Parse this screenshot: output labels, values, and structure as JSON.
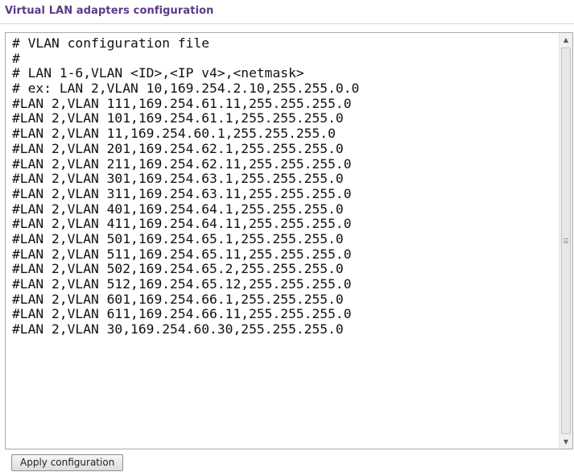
{
  "section": {
    "title": "Virtual LAN adapters configuration"
  },
  "editor": {
    "lines": [
      "# VLAN configuration file",
      "#",
      "# LAN 1-6,VLAN <ID>,<IP v4>,<netmask>",
      "# ex: LAN 2,VLAN 10,169.254.2.10,255.255.0.0",
      "#LAN 2,VLAN 111,169.254.61.11,255.255.255.0",
      "#LAN 2,VLAN 101,169.254.61.1,255.255.255.0",
      "#LAN 2,VLAN 11,169.254.60.1,255.255.255.0",
      "#LAN 2,VLAN 201,169.254.62.1,255.255.255.0",
      "#LAN 2,VLAN 211,169.254.62.11,255.255.255.0",
      "#LAN 2,VLAN 301,169.254.63.1,255.255.255.0",
      "#LAN 2,VLAN 311,169.254.63.11,255.255.255.0",
      "#LAN 2,VLAN 401,169.254.64.1,255.255.255.0",
      "#LAN 2,VLAN 411,169.254.64.11,255.255.255.0",
      "#LAN 2,VLAN 501,169.254.65.1,255.255.255.0",
      "#LAN 2,VLAN 511,169.254.65.11,255.255.255.0",
      "#LAN 2,VLAN 502,169.254.65.2,255.255.255.0",
      "#LAN 2,VLAN 512,169.254.65.12,255.255.255.0",
      "#LAN 2,VLAN 601,169.254.66.1,255.255.255.0",
      "#LAN 2,VLAN 611,169.254.66.11,255.255.255.0",
      "#LAN 2,VLAN 30,169.254.60.30,255.255.255.0"
    ]
  },
  "scrollbar": {
    "up_icon": "scroll-up-arrow-icon",
    "down_icon": "scroll-down-arrow-icon"
  },
  "actions": {
    "apply_label": "Apply configuration"
  },
  "colors": {
    "title": "#5b3a86",
    "text": "#111111",
    "border": "#a9a9a9"
  }
}
